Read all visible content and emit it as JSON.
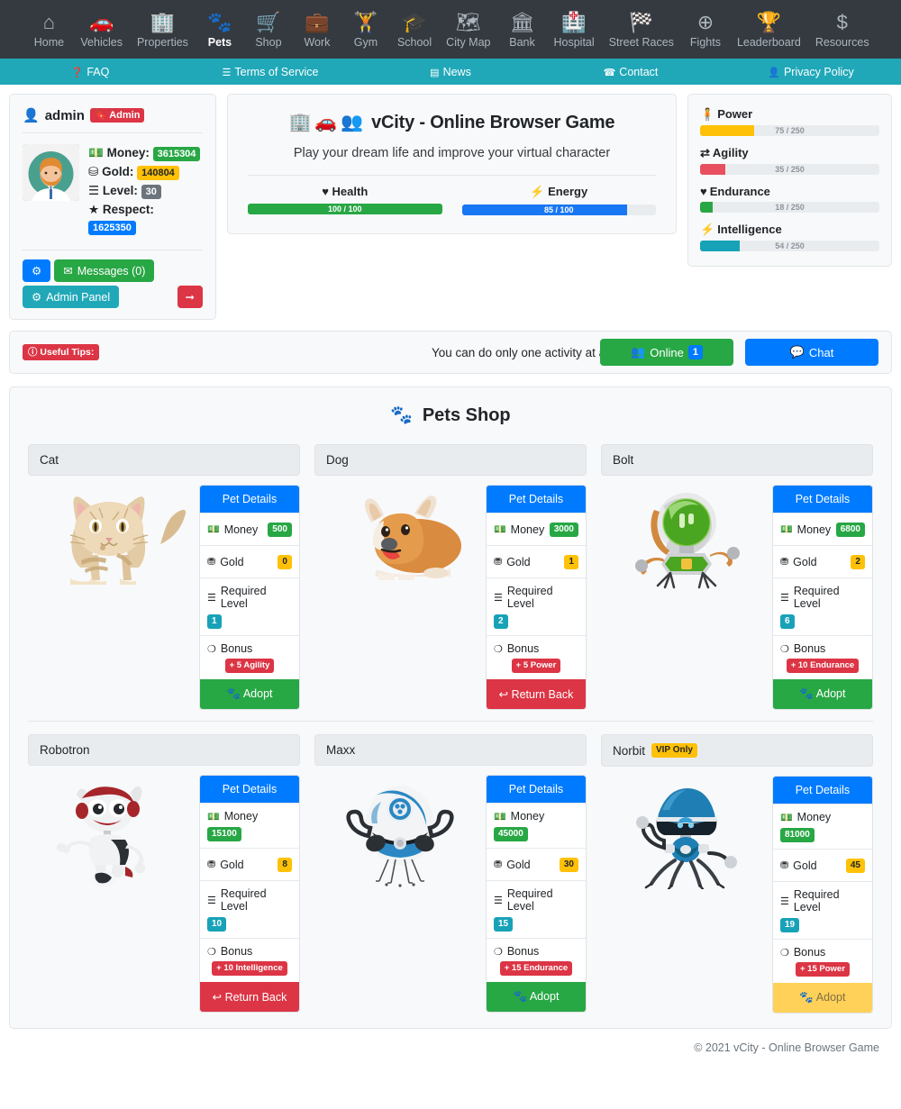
{
  "topnav": {
    "items": [
      {
        "label": "Home",
        "icon": "home-icon",
        "glyph": "⌂",
        "active": false
      },
      {
        "label": "Vehicles",
        "icon": "car-icon",
        "glyph": "🚗",
        "active": false
      },
      {
        "label": "Properties",
        "icon": "building-icon",
        "glyph": "🏢",
        "active": false
      },
      {
        "label": "Pets",
        "icon": "paw-icon",
        "glyph": "🐾",
        "active": true
      },
      {
        "label": "Shop",
        "icon": "shopping-cart-icon",
        "glyph": "🛒",
        "active": false
      },
      {
        "label": "Work",
        "icon": "briefcase-icon",
        "glyph": "💼",
        "active": false
      },
      {
        "label": "Gym",
        "icon": "dumbbell-icon",
        "glyph": "🏋",
        "active": false
      },
      {
        "label": "School",
        "icon": "graduation-cap-icon",
        "glyph": "🎓",
        "active": false
      },
      {
        "label": "City Map",
        "icon": "map-icon",
        "glyph": "🗺",
        "active": false
      },
      {
        "label": "Bank",
        "icon": "bank-icon",
        "glyph": "🏛",
        "active": false
      },
      {
        "label": "Hospital",
        "icon": "hospital-icon",
        "glyph": "🏥",
        "active": false
      },
      {
        "label": "Street Races",
        "icon": "checkered-flag-icon",
        "glyph": "🏁",
        "active": false
      },
      {
        "label": "Fights",
        "icon": "crosshairs-icon",
        "glyph": "⊕",
        "active": false
      },
      {
        "label": "Leaderboard",
        "icon": "trophy-icon",
        "glyph": "🏆",
        "active": false
      },
      {
        "label": "Resources",
        "icon": "dollar-icon",
        "glyph": "$",
        "active": false
      }
    ]
  },
  "subnav": {
    "items": [
      {
        "label": "FAQ",
        "icon": "question-circle-icon",
        "glyph": "❓"
      },
      {
        "label": "Terms of Service",
        "icon": "list-icon",
        "glyph": "☰"
      },
      {
        "label": "News",
        "icon": "newspaper-icon",
        "glyph": "▤"
      },
      {
        "label": "Contact",
        "icon": "headset-icon",
        "glyph": "☎"
      },
      {
        "label": "Privacy Policy",
        "icon": "user-shield-icon",
        "glyph": "👤"
      }
    ]
  },
  "profile": {
    "username": "admin",
    "role_badge": "Admin",
    "stats": [
      {
        "label": "Money:",
        "value": "3615304",
        "icon": "money-bill-icon",
        "glyph": "💵",
        "color": "green"
      },
      {
        "label": "Gold:",
        "value": "140804",
        "icon": "gold-bar-icon",
        "glyph": "⛁",
        "color": "yellow"
      },
      {
        "label": "Level:",
        "value": "30",
        "icon": "layers-icon",
        "glyph": "☰",
        "color": "gray"
      },
      {
        "label": "Respect:",
        "value": "1625350",
        "icon": "star-icon",
        "glyph": "★",
        "color": "blue"
      }
    ],
    "settings_button": "",
    "messages_button": "Messages (0)",
    "admin_panel_button": "Admin Panel",
    "logout_button": ""
  },
  "center": {
    "title": "vCity - Online Browser Game",
    "title_icons": [
      "building-icon",
      "car-icon",
      "users-icon"
    ],
    "subtitle": "Play your dream life and improve your virtual character",
    "bars": [
      {
        "label": "Health",
        "icon": "heart-icon",
        "glyph": "♥",
        "text": "100 / 100",
        "percent": 100,
        "color": "#28a745"
      },
      {
        "label": "Energy",
        "icon": "bolt-icon",
        "glyph": "⚡",
        "text": "85 / 100",
        "percent": 85,
        "color": "#1877f2"
      }
    ]
  },
  "attributes": [
    {
      "label": "Power",
      "icon": "person-icon",
      "glyph": "🧍",
      "text": "75 / 250",
      "percent": 30,
      "color": "#ffc107"
    },
    {
      "label": "Agility",
      "icon": "exchange-icon",
      "glyph": "⇄",
      "text": "35 / 250",
      "percent": 14,
      "color": "#e8505f"
    },
    {
      "label": "Endurance",
      "icon": "heartbeat-icon",
      "glyph": "♥",
      "text": "18 / 250",
      "percent": 7,
      "color": "#28a745"
    },
    {
      "label": "Intelligence",
      "icon": "brain-icon",
      "glyph": "⚡",
      "text": "54 / 250",
      "percent": 22,
      "color": "#17a2b8"
    }
  ],
  "tips": {
    "badge": "Useful Tips:",
    "badge_icon": "info-circle-icon",
    "text": "You can do only one activity at a time",
    "online_button": "Online",
    "online_count": "1",
    "chat_button": "Chat"
  },
  "shop": {
    "title": "Pets Shop",
    "title_icon": "paw-icon",
    "panel_title": "Pet Details",
    "labels": {
      "money": "Money",
      "gold": "Gold",
      "required_level": "Required Level",
      "bonus": "Bonus"
    },
    "pets": [
      {
        "name": "Cat",
        "vip": null,
        "art": "cat",
        "money": "500",
        "gold": "0",
        "level": "1",
        "bonus": "+ 5 Agility",
        "action": "Adopt",
        "action_style": "green",
        "action_icon": "paw-icon"
      },
      {
        "name": "Dog",
        "vip": null,
        "art": "dog",
        "money": "3000",
        "gold": "1",
        "level": "2",
        "bonus": "+ 5 Power",
        "action": "Return Back",
        "action_style": "red",
        "action_icon": "undo-icon"
      },
      {
        "name": "Bolt",
        "vip": null,
        "art": "bolt",
        "money": "6800",
        "gold": "2",
        "level": "6",
        "bonus": "+ 10 Endurance",
        "action": "Adopt",
        "action_style": "green",
        "action_icon": "paw-icon"
      },
      {
        "name": "Robotron",
        "vip": null,
        "art": "robotron",
        "money": "15100",
        "gold": "8",
        "level": "10",
        "bonus": "+ 10 Intelligence",
        "action": "Return Back",
        "action_style": "red",
        "action_icon": "undo-icon"
      },
      {
        "name": "Maxx",
        "vip": null,
        "art": "maxx",
        "money": "45000",
        "gold": "30",
        "level": "15",
        "bonus": "+ 15 Endurance",
        "action": "Adopt",
        "action_style": "green",
        "action_icon": "paw-icon"
      },
      {
        "name": "Norbit",
        "vip": "VIP Only",
        "art": "norbit",
        "money": "81000",
        "gold": "45",
        "level": "19",
        "bonus": "+ 15 Power",
        "action": "Adopt",
        "action_style": "yellow",
        "action_icon": "paw-icon"
      }
    ]
  },
  "footer": {
    "text": "© 2021 vCity - Online Browser Game"
  },
  "colors": {
    "nav_bg": "#343a40",
    "subnav_bg": "#20a8b8",
    "primary": "#007bff",
    "success": "#28a745",
    "danger": "#dc3545",
    "warning": "#ffc107",
    "info": "#17a2b8"
  }
}
